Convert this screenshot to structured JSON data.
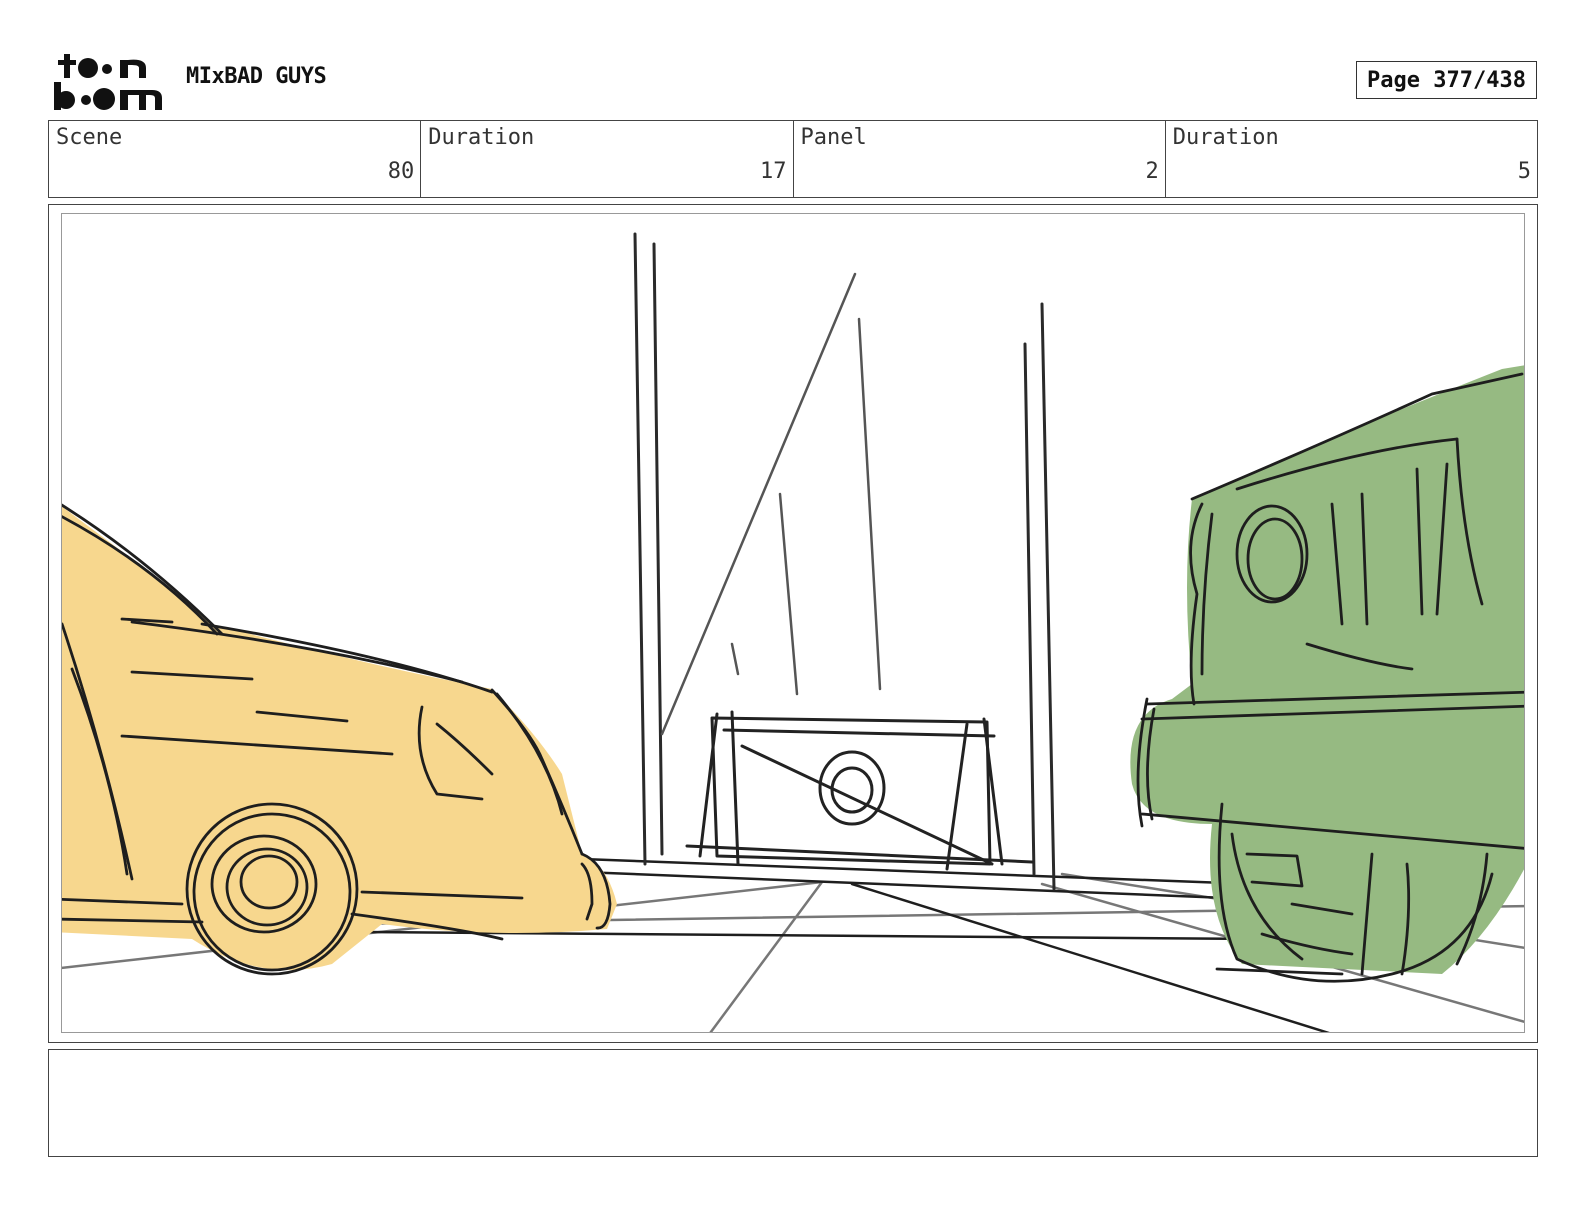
{
  "header": {
    "logo_text_top": "toon",
    "logo_text_bottom": "boom",
    "project_title": "MIxBAD GUYS",
    "page_label": "Page",
    "page_value": "377/438"
  },
  "info": {
    "scene_label": "Scene",
    "scene_value": "80",
    "scene_duration_label": "Duration",
    "scene_duration_value": "17",
    "panel_label": "Panel",
    "panel_value": "2",
    "panel_duration_label": "Duration",
    "panel_duration_value": "5"
  },
  "panel_image": {
    "colors": {
      "taxi_fill": "#f7d78e",
      "truck_fill": "#96ba82",
      "line": "#1e1e1e",
      "grey_line": "#777777"
    }
  },
  "notes": {
    "text": ""
  }
}
